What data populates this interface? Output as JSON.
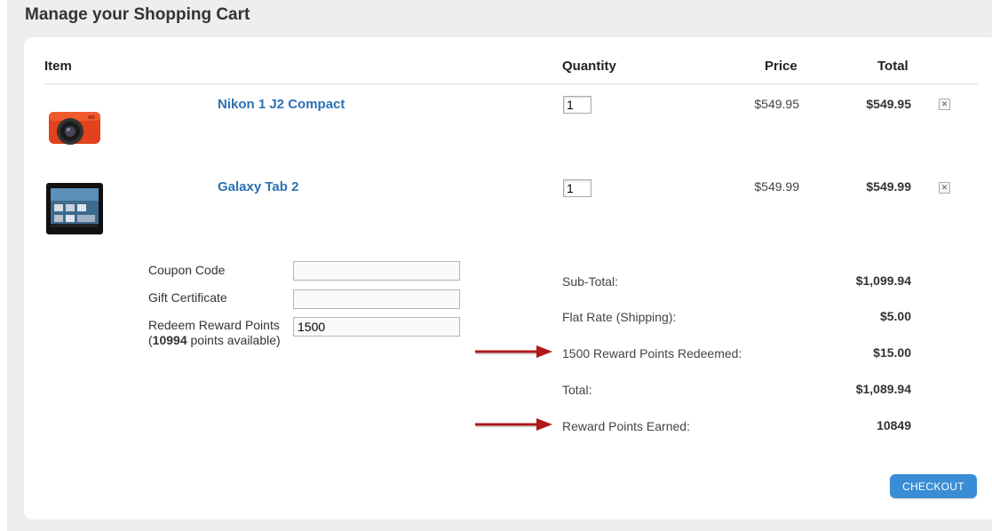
{
  "page": {
    "title": "Manage your Shopping Cart"
  },
  "table": {
    "headers": {
      "item": "Item",
      "quantity": "Quantity",
      "price": "Price",
      "total": "Total"
    },
    "rows": [
      {
        "name": "Nikon 1 J2 Compact",
        "quantity": "1",
        "price": "$549.95",
        "total": "$549.95",
        "image": "orange-camera"
      },
      {
        "name": "Galaxy Tab 2",
        "quantity": "1",
        "price": "$549.99",
        "total": "$549.99",
        "image": "tablet"
      }
    ],
    "remove_icon": "close-icon"
  },
  "form": {
    "coupon_label": "Coupon Code",
    "coupon_value": "",
    "gift_label": "Gift Certificate",
    "gift_value": "",
    "reward_label": "Redeem Reward Points",
    "reward_value": "1500",
    "available_prefix": "(",
    "available_points": "10994",
    "available_suffix": " points available)"
  },
  "summary": {
    "subtotal_label": "Sub-Total:",
    "subtotal_value": "$1,099.94",
    "shipping_label": "Flat Rate (Shipping):",
    "shipping_value": "$5.00",
    "redeemed_label": "1500 Reward Points Redeemed:",
    "redeemed_value": "$15.00",
    "total_label": "Total:",
    "total_value": "$1,089.94",
    "earned_label": "Reward Points Earned:",
    "earned_value": "10849"
  },
  "checkout_label": "CHECKOUT",
  "colors": {
    "link": "#2a72b5",
    "button": "#3a8dd4",
    "arrow": "#b01818"
  }
}
